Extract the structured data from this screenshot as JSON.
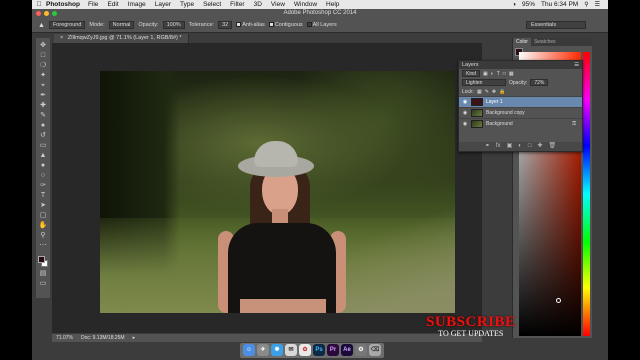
{
  "menubar": {
    "app_name": "Photoshop",
    "items": [
      "File",
      "Edit",
      "Image",
      "Layer",
      "Type",
      "Select",
      "Filter",
      "3D",
      "View",
      "Window",
      "Help"
    ],
    "battery": "95%",
    "clock": "Thu 6:34 PM"
  },
  "window": {
    "title": "Adobe Photoshop CC 2014"
  },
  "options_bar": {
    "tool_preset": "Foreground",
    "mode_label": "Mode:",
    "mode_value": "Normal",
    "opacity_label": "Opacity:",
    "opacity_value": "100%",
    "tolerance_label": "Tolerance:",
    "tolerance_value": "32",
    "anti_alias": "Anti-alias",
    "contiguous": "Contiguous",
    "all_layers": "All Layers",
    "workspace": "Essentials"
  },
  "document": {
    "tab_title": "ZIllmqwZyJ9.jpg @ 71.1% (Layer 1, RGB/8#) *",
    "zoom": "71.07%",
    "doc_size": "Doc: 9.13M/18.25M"
  },
  "layers_panel": {
    "title": "Layers",
    "kind_filter": "Kind",
    "blend_mode": "Lighten",
    "opacity_label": "Opacity:",
    "opacity_value": "72%",
    "lock_label": "Lock:",
    "layers": [
      {
        "name": "Layer 1",
        "active": true
      },
      {
        "name": "Background copy",
        "active": false
      },
      {
        "name": "Background",
        "active": false
      }
    ]
  },
  "color_panel": {
    "tabs": [
      "Color",
      "Swatches"
    ]
  },
  "overlay": {
    "subscribe": "SUBSCRIBE",
    "subtitle": "TO GET UPDATES"
  },
  "colors": {
    "foreground": "#2a1014",
    "selected_layer": "#6889ad"
  },
  "dock": {
    "icons": [
      "finder-icon",
      "launchpad-icon",
      "safari-icon",
      "mail-icon",
      "photos-icon",
      "photoshop-icon",
      "premiere-icon",
      "after-effects-icon",
      "system-preferences-icon",
      "trash-icon"
    ]
  }
}
